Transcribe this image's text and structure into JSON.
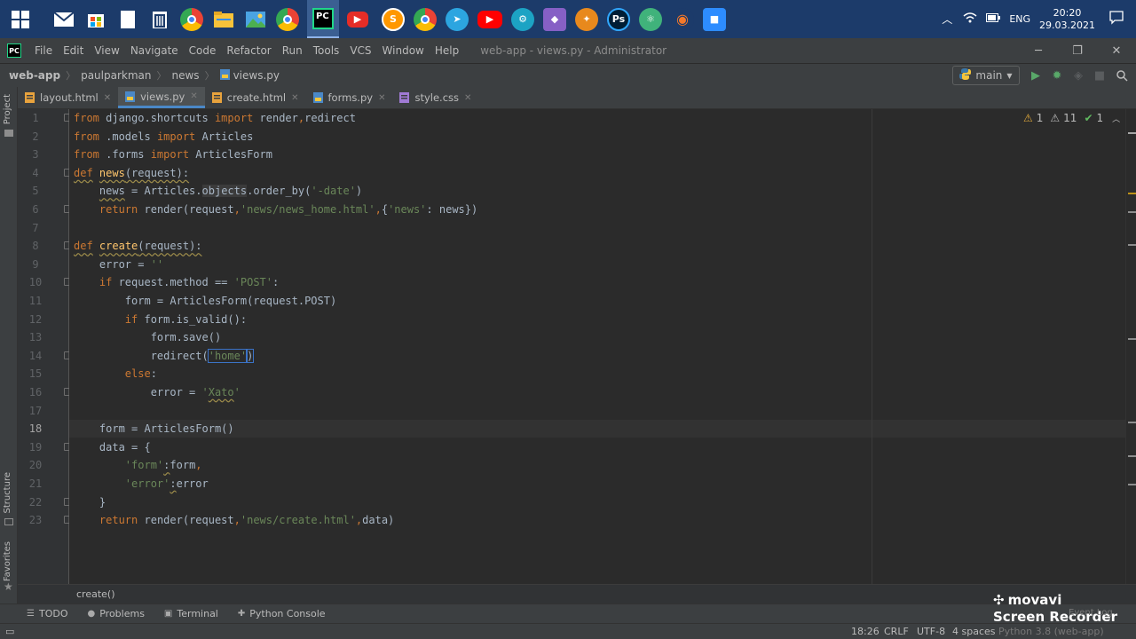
{
  "taskbar": {
    "apps": [
      "Mail",
      "Microsoft Store",
      "Notepad",
      "Recycle Bin",
      "Google Chrome",
      "File Explorer",
      "Photos",
      "Chrome Remote",
      "PyCharm",
      "YouTube app",
      "Sublime Text",
      "Google Chrome",
      "Telegram",
      "YouTube",
      "Network tool",
      "Visual Studio",
      "Reader",
      "Photoshop",
      "Atom",
      "Blender",
      "Zoom"
    ],
    "tray_lang": "ENG",
    "clock_time": "20:20",
    "clock_date": "29.03.2021"
  },
  "menu": {
    "items": [
      "File",
      "Edit",
      "View",
      "Navigate",
      "Code",
      "Refactor",
      "Run",
      "Tools",
      "VCS",
      "Window",
      "Help"
    ],
    "window_title": "web-app - views.py - Administrator"
  },
  "nav": {
    "crumbs": [
      "web-app",
      "paulparkman",
      "news",
      "views.py"
    ],
    "branch": "main"
  },
  "tabs": [
    {
      "label": "layout.html",
      "icon_color": "#e8a33d"
    },
    {
      "label": "views.py",
      "icon_color": "#4a88c7"
    },
    {
      "label": "create.html",
      "icon_color": "#e8a33d"
    },
    {
      "label": "forms.py",
      "icon_color": "#4a88c7"
    },
    {
      "label": "style.css",
      "icon_color": "#a07ad4"
    }
  ],
  "side_labels": {
    "project": "Project",
    "structure": "Structure",
    "favorites": "Favorites"
  },
  "line_numbers": [
    "1",
    "2",
    "3",
    "4",
    "5",
    "6",
    "7",
    "8",
    "9",
    "10",
    "11",
    "12",
    "13",
    "14",
    "15",
    "16",
    "17",
    "18",
    "19",
    "20",
    "21",
    "22",
    "23"
  ],
  "code": {
    "l1": {
      "a": "from",
      "b": " django.shortcuts ",
      "c": "import",
      "d": " render",
      "e": ",",
      "f": "redirect"
    },
    "l2": {
      "a": "from",
      "b": " .models ",
      "c": "import",
      "d": " Articles"
    },
    "l3": {
      "a": "from",
      "b": " .forms ",
      "c": "import",
      "d": " ArticlesForm"
    },
    "l4": {
      "a": "def",
      "b": " ",
      "c": "news",
      "d": "(request):"
    },
    "l5": {
      "a": "    ",
      "b": "news",
      "c": " = Articles.",
      "d": "objects",
      "e": ".order_by(",
      "f": "'-date'",
      "g": ")"
    },
    "l6": {
      "a": "    ",
      "b": "return",
      "c": " render(request",
      "d": ",",
      "e": "'news/news_home.html'",
      "f": ",",
      "g": "{",
      "h": "'news'",
      "i": ": news})"
    },
    "l8": {
      "a": "def",
      "b": " ",
      "c": "create",
      "d": "(request):"
    },
    "l9": {
      "a": "    error = ",
      "b": "''"
    },
    "l10": {
      "a": "    ",
      "b": "if",
      "c": " request.method == ",
      "d": "'POST'",
      "e": ":"
    },
    "l11": {
      "a": "        form = ArticlesForm(request.POST)"
    },
    "l12": {
      "a": "        ",
      "b": "if",
      "c": " form.is_valid():"
    },
    "l13": {
      "a": "            form.save()"
    },
    "l14": {
      "a": "            redirect(",
      "b": "'home'",
      "c": ")"
    },
    "l15": {
      "a": "        ",
      "b": "else",
      "c": ":"
    },
    "l16": {
      "a": "            error = ",
      "b": "'",
      "c": "Xato",
      "d": "'"
    },
    "l18": {
      "a": "    form = ArticlesForm()"
    },
    "l19": {
      "a": "    data = {"
    },
    "l20": {
      "a": "        ",
      "b": "'form'",
      "c": ":",
      "d": "form",
      "e": ","
    },
    "l21": {
      "a": "        ",
      "b": "'error'",
      "c": ":",
      "d": "error"
    },
    "l22": {
      "a": "    }"
    },
    "l23": {
      "a": "    ",
      "b": "return",
      "c": " render(request",
      "d": ",",
      "e": "'news/create.html'",
      "f": ",",
      "g": "data)"
    }
  },
  "inspections": {
    "warnings": "1",
    "weak_warnings": "11",
    "ok": "1"
  },
  "editor_breadcrumb": "create()",
  "tool_windows": [
    "TODO",
    "Problems",
    "Terminal",
    "Python Console"
  ],
  "status": {
    "position": "18:26",
    "line_sep": "CRLF",
    "encoding": "UTF-8",
    "indent": "4 spaces",
    "interpreter": "Python 3.8 (web-app)",
    "event_log": "Event Log"
  },
  "watermark": {
    "brand": "movavi",
    "product": "Screen Recorder"
  },
  "colors": {
    "keyword": "#cc7832",
    "string": "#6a8759",
    "function": "#ffc66d",
    "text": "#a9b7c6",
    "accent": "#4a88c7"
  }
}
